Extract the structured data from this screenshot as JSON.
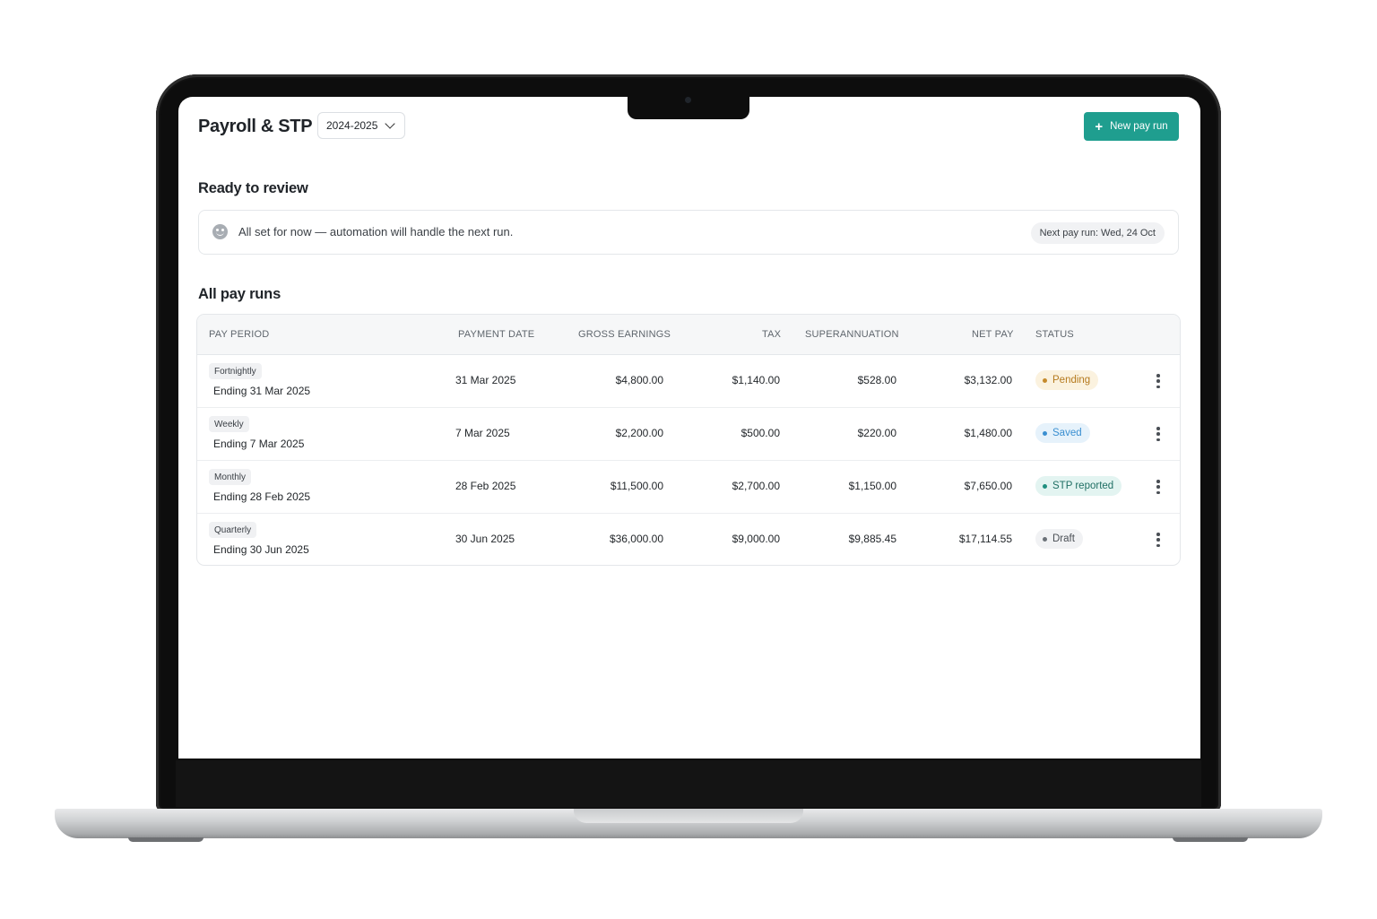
{
  "header": {
    "title": "Payroll & STP",
    "year_select": "2024-2025",
    "new_button": "New pay run"
  },
  "review": {
    "title": "Ready to review",
    "message": "All set for now — automation will handle the next run.",
    "next_pay_run": "Next pay run: Wed, 24 Oct"
  },
  "pay_runs": {
    "title": "All pay runs",
    "columns": [
      "PAY PERIOD",
      "PAYMENT DATE",
      "GROSS EARNINGS",
      "TAX",
      "SUPERANNUATION",
      "NET PAY",
      "STATUS"
    ],
    "rows": [
      {
        "frequency": "Fortnightly",
        "ending": "Ending 31 Mar 2025",
        "payment_date": "31 Mar 2025",
        "gross": "$4,800.00",
        "tax": "$1,140.00",
        "super": "$528.00",
        "net": "$3,132.00",
        "status": "Pending"
      },
      {
        "frequency": "Weekly",
        "ending": "Ending 7 Mar 2025",
        "payment_date": "7 Mar 2025",
        "gross": "$2,200.00",
        "tax": "$500.00",
        "super": "$220.00",
        "net": "$1,480.00",
        "status": "Saved"
      },
      {
        "frequency": "Monthly",
        "ending": "Ending 28 Feb 2025",
        "payment_date": "28 Feb 2025",
        "gross": "$11,500.00",
        "tax": "$2,700.00",
        "super": "$1,150.00",
        "net": "$7,650.00",
        "status": "STP reported"
      },
      {
        "frequency": "Quarterly",
        "ending": "Ending 30 Jun 2025",
        "payment_date": "30 Jun 2025",
        "gross": "$36,000.00",
        "tax": "$9,000.00",
        "super": "$9,885.45",
        "net": "$17,114.55",
        "status": "Draft"
      }
    ]
  },
  "colors": {
    "accent": "#1f9e8f",
    "status_pending": "#c58a2b",
    "status_saved": "#3a8fd1",
    "status_stp": "#1f8f7f",
    "status_draft": "#6b7178"
  },
  "icons": [
    "plus-icon",
    "chevron-down-icon",
    "smile-icon",
    "kebab-menu-icon"
  ]
}
